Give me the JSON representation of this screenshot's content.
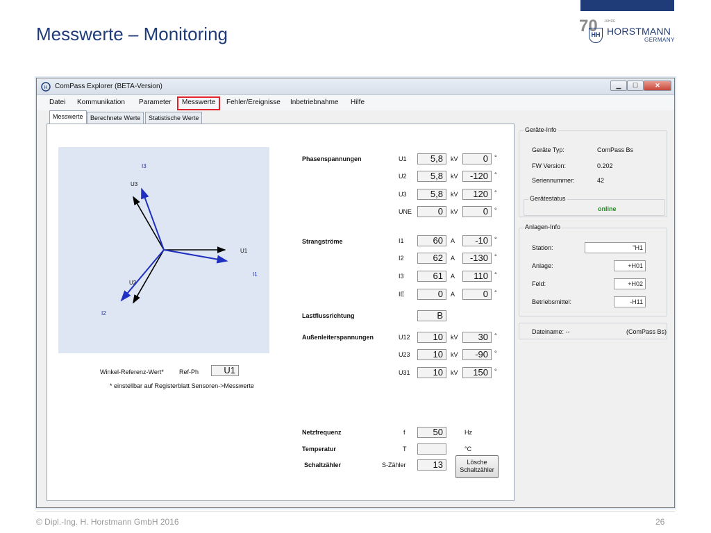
{
  "slide": {
    "title": "Messwerte – Monitoring",
    "footer": "© Dipl.-Ing. H. Horstmann GmbH 2016",
    "page_number": "26",
    "logo": {
      "seventy": "70",
      "jahre": "JAHRE",
      "monogram": "HH",
      "brand": "HORSTMANN",
      "country": "GERMANY"
    },
    "colors": {
      "title_blue": "#1f3b78",
      "highlight_red": "#e3232a",
      "status_green": "#1e8a1e"
    }
  },
  "window": {
    "title": "ComPass Explorer (BETA-Version)",
    "buttons": {
      "minimize": "▁",
      "maximize": "☐",
      "close": "✕"
    },
    "menu": [
      "Datei",
      "Kommunikation",
      "Parameter",
      "Messwerte",
      "Fehler/Ereignisse",
      "Inbetriebnahme",
      "Hilfe"
    ],
    "tabs": [
      "Messwerte",
      "Berechnete Werte",
      "Statistische Werte"
    ]
  },
  "phasor": {
    "labels": {
      "i3": "I3",
      "u3": "U3",
      "u1": "U1",
      "i1": "I1",
      "i2": "I2",
      "u2": "U2"
    },
    "angles_deg": {
      "U1": 0,
      "U2": -120,
      "U3": 120,
      "I1": -10,
      "I2": -130,
      "I3": 110
    },
    "magnitudes": {
      "U1": 5.8,
      "U2": 5.8,
      "U3": 5.8,
      "I1": 60,
      "I2": 62,
      "I3": 61
    },
    "voltage_color": "#000000",
    "current_color": "#1f2fbf"
  },
  "reference": {
    "label": "Winkel-Referenz-Wert*",
    "ref_label": "Ref-Ph",
    "ref_value": "U1",
    "note": "* einstellbar auf Registerblatt Sensoren->Messwerte"
  },
  "measurements": {
    "phasenspannungen": {
      "title": "Phasenspannungen",
      "rows": [
        {
          "name": "U1",
          "value": "5,8",
          "unit": "kV",
          "angle": "0",
          "deg": "°"
        },
        {
          "name": "U2",
          "value": "5,8",
          "unit": "kV",
          "angle": "-120",
          "deg": "°"
        },
        {
          "name": "U3",
          "value": "5,8",
          "unit": "kV",
          "angle": "120",
          "deg": "°"
        },
        {
          "name": "UNE",
          "value": "0",
          "unit": "kV",
          "angle": "0",
          "deg": "°"
        }
      ]
    },
    "strangstroeme": {
      "title": "Strangströme",
      "rows": [
        {
          "name": "I1",
          "value": "60",
          "unit": "A",
          "angle": "-10",
          "deg": "°"
        },
        {
          "name": "I2",
          "value": "62",
          "unit": "A",
          "angle": "-130",
          "deg": "°"
        },
        {
          "name": "I3",
          "value": "61",
          "unit": "A",
          "angle": "110",
          "deg": "°"
        },
        {
          "name": "IE",
          "value": "0",
          "unit": "A",
          "angle": "0",
          "deg": "°"
        }
      ]
    },
    "lastfluss": {
      "title": "Lastflussrichtung",
      "value": "B"
    },
    "aussenleiter": {
      "title": "Außenleiterspannungen",
      "rows": [
        {
          "name": "U12",
          "value": "10",
          "unit": "kV",
          "angle": "30",
          "deg": "°"
        },
        {
          "name": "U23",
          "value": "10",
          "unit": "kV",
          "angle": "-90",
          "deg": "°"
        },
        {
          "name": "U31",
          "value": "10",
          "unit": "kV",
          "angle": "150",
          "deg": "°"
        }
      ]
    },
    "netzfrequenz": {
      "title": "Netzfrequenz",
      "symbol": "f",
      "value": "50",
      "unit": "Hz"
    },
    "temperatur": {
      "title": "Temperatur",
      "symbol": "T",
      "value": "",
      "unit": "°C"
    },
    "schaltzaehler": {
      "title": "Schaltzähler",
      "symbol": "S-Zähler",
      "value": "13",
      "button_line1": "Lösche",
      "button_line2": "Schaltzähler"
    }
  },
  "geraete_info": {
    "title": "Geräte-Info",
    "typ_label": "Geräte Typ:",
    "typ_value": "ComPass Bs",
    "fw_label": "FW Version:",
    "fw_value": "0.202",
    "sn_label": "Seriennummer:",
    "sn_value": "42",
    "status_title": "Gerätestatus",
    "status_value": "online"
  },
  "anlagen_info": {
    "title": "Anlagen-Info",
    "station_label": "Station:",
    "station_value": "\"H1",
    "anlage_label": "Anlage:",
    "anlage_value": "+H01",
    "feld_label": "Feld:",
    "feld_value": "+H02",
    "bm_label": "Betriebsmittel:",
    "bm_value": "-H11"
  },
  "datei": {
    "label": "Dateiname: --",
    "value": "(ComPass Bs)"
  }
}
